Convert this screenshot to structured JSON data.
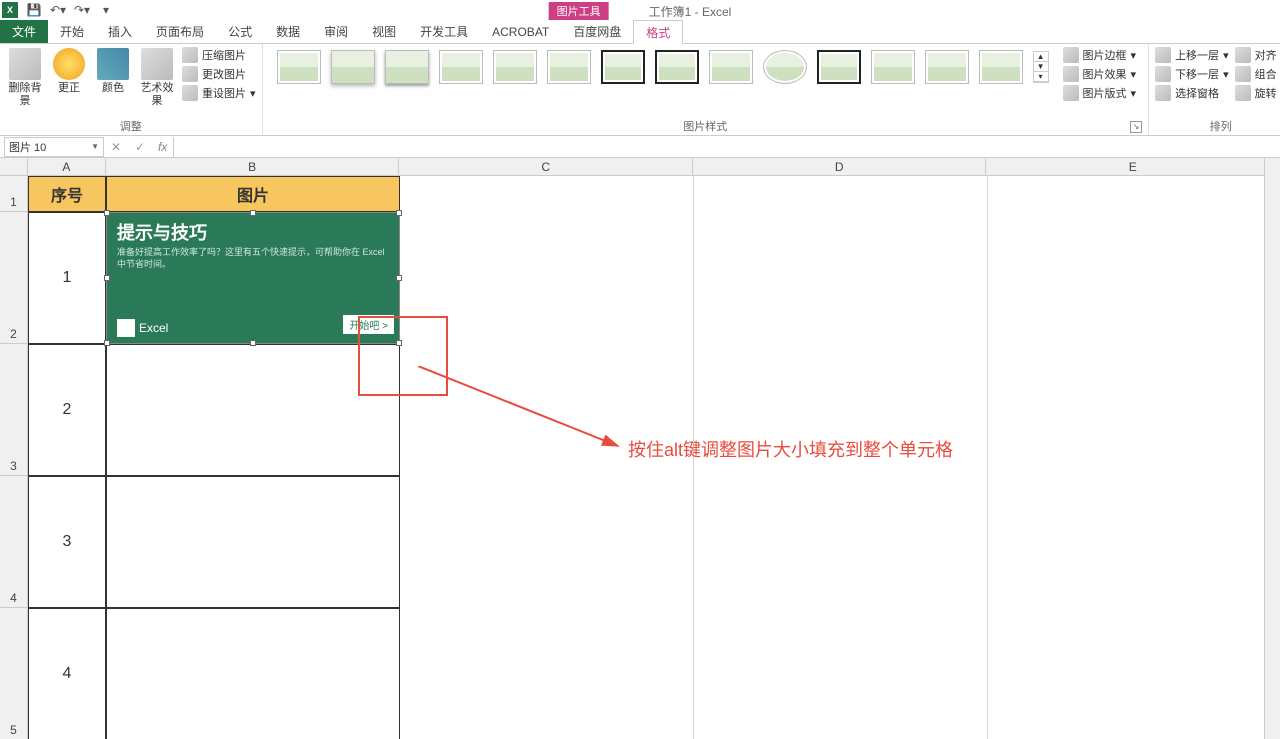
{
  "titlebar": {
    "tool_context": "图片工具",
    "doc_title": "工作簿1 - Excel"
  },
  "tabs": {
    "file": "文件",
    "items": [
      "开始",
      "插入",
      "页面布局",
      "公式",
      "数据",
      "审阅",
      "视图",
      "开发工具",
      "ACROBAT",
      "百度网盘"
    ],
    "active": "格式"
  },
  "ribbon": {
    "adjust": {
      "remove_bg": "删除背景",
      "corrections": "更正",
      "color": "颜色",
      "artistic": "艺术效果",
      "compress": "压缩图片",
      "change": "更改图片",
      "reset": "重设图片",
      "group_label": "调整"
    },
    "styles_label": "图片样式",
    "pic_border": "图片边框",
    "pic_effects": "图片效果",
    "pic_layout": "图片版式",
    "arrange": {
      "bring_fwd": "上移一层",
      "send_back": "下移一层",
      "selection_pane": "选择窗格",
      "align": "对齐",
      "group": "组合",
      "rotate": "旋转",
      "group_label": "排列"
    }
  },
  "namebox": "图片 10",
  "columns": [
    "A",
    "B",
    "C",
    "D",
    "E"
  ],
  "headers": {
    "A": "序号",
    "B": "图片"
  },
  "rows": [
    "1",
    "2",
    "3",
    "4"
  ],
  "picture": {
    "title": "提示与技巧",
    "subtitle": "准备好提高工作效率了吗？这里有五个快速提示，可帮助你在 Excel 中节省时间。",
    "footer": "Excel",
    "start_btn": "开始吧 >"
  },
  "annotation": "按住alt键调整图片大小填充到整个单元格"
}
